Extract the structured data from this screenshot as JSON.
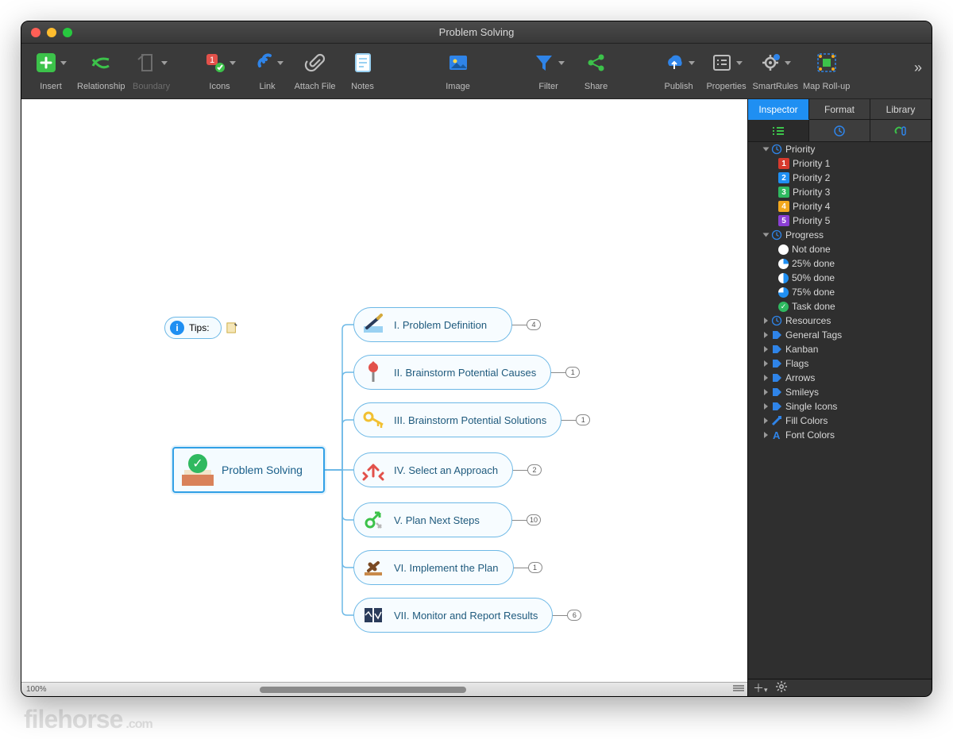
{
  "window": {
    "title": "Problem Solving"
  },
  "toolbar": {
    "items": [
      {
        "label": "Insert",
        "dropdown": true,
        "color": "#3cc24a",
        "dim": false
      },
      {
        "label": "Relationship",
        "dropdown": false,
        "color": "#3cc24a",
        "dim": false
      },
      {
        "label": "Boundary",
        "dropdown": true,
        "color": "#3cc24a",
        "dim": true
      },
      {
        "label": "Icons",
        "dropdown": true,
        "color": "#e2514a",
        "dim": false
      },
      {
        "label": "Link",
        "dropdown": true,
        "color": "#2f84e8",
        "dim": false
      },
      {
        "label": "Attach File",
        "dropdown": false,
        "color": "#bdbdbd",
        "dim": false
      },
      {
        "label": "Notes",
        "dropdown": false,
        "color": "#9ad1f2",
        "dim": false
      },
      {
        "label": "Image",
        "dropdown": false,
        "color": "#2f84e8",
        "dim": false
      },
      {
        "label": "Filter",
        "dropdown": true,
        "color": "#2f84e8",
        "dim": false
      },
      {
        "label": "Share",
        "dropdown": false,
        "color": "#3cc24a",
        "dim": false
      },
      {
        "label": "Publish",
        "dropdown": true,
        "color": "#2f84e8",
        "dim": false
      },
      {
        "label": "Properties",
        "dropdown": true,
        "color": "#bdbdbd",
        "dim": false
      },
      {
        "label": "SmartRules",
        "dropdown": true,
        "color": "#2f84e8",
        "dim": false
      },
      {
        "label": "Map Roll-up",
        "dropdown": false,
        "color": "#2f84e8",
        "dim": false
      }
    ]
  },
  "map": {
    "central": "Problem Solving",
    "tips": "Tips:",
    "children": [
      {
        "numeral": "I.",
        "title": "Problem Definition",
        "count": "4"
      },
      {
        "numeral": "II.",
        "title": "Brainstorm Potential Causes",
        "count": "1"
      },
      {
        "numeral": "III.",
        "title": "Brainstorm Potential Solutions",
        "count": "1"
      },
      {
        "numeral": "IV.",
        "title": "Select an Approach",
        "count": "2"
      },
      {
        "numeral": "V.",
        "title": "Plan Next Steps",
        "count": "10"
      },
      {
        "numeral": "VI.",
        "title": "Implement the Plan",
        "count": "1"
      },
      {
        "numeral": "VII.",
        "title": "Monitor and Report Results",
        "count": "6"
      }
    ]
  },
  "panel": {
    "tabs": [
      "Inspector",
      "Format",
      "Library"
    ],
    "groups": {
      "priority": {
        "label": "Priority",
        "items": [
          "Priority 1",
          "Priority 2",
          "Priority 3",
          "Priority 4",
          "Priority 5"
        ],
        "colors": [
          "#d83a2e",
          "#1f8ff2",
          "#2fb960",
          "#f2a81f",
          "#8b3fd4"
        ]
      },
      "progress": {
        "label": "Progress",
        "items": [
          "Not done",
          "25% done",
          "50% done",
          "75% done",
          "Task done"
        ]
      },
      "others": [
        "Resources",
        "General Tags",
        "Kanban",
        "Flags",
        "Arrows",
        "Smileys",
        "Single Icons",
        "Fill Colors",
        "Font Colors"
      ]
    }
  },
  "status": {
    "zoom": "100%"
  },
  "watermark": {
    "brand": "filehorse",
    "tld": ".com"
  }
}
